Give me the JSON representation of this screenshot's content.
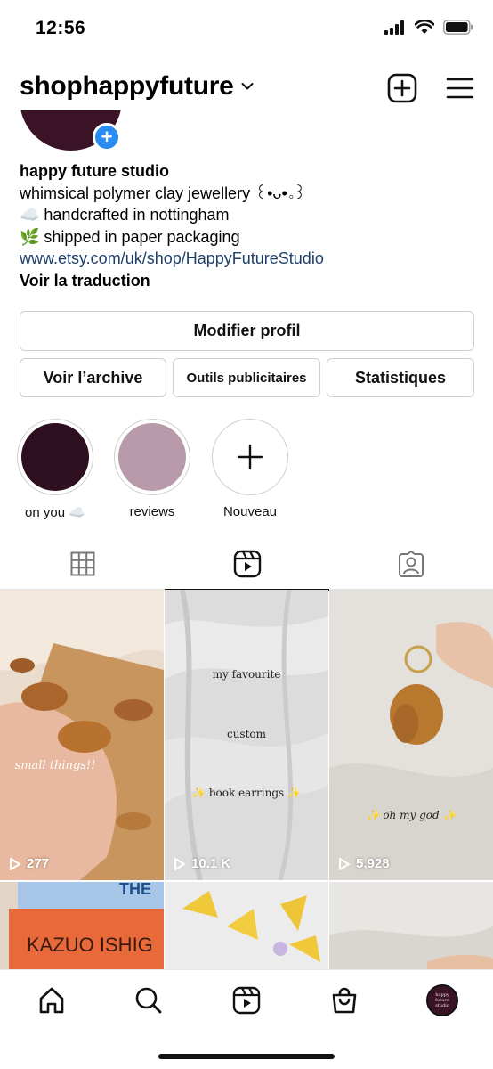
{
  "status_bar": {
    "time": "12:56"
  },
  "header": {
    "username": "shophappyfuture"
  },
  "profile": {
    "display_name": "happy future studio",
    "bio_lines": [
      "whimsical polymer clay jewellery ꒰•ᴗ•｡꒱",
      "☁️ handcrafted in nottingham",
      "🌿 shipped in paper packaging"
    ],
    "link": "www.etsy.com/uk/shop/HappyFutureStudio",
    "translate_label": "Voir la traduction"
  },
  "buttons": {
    "edit_profile": "Modifier profil",
    "archive": "Voir l’archive",
    "ad_tools": "Outils publicitaires",
    "insights": "Statistiques"
  },
  "highlights": [
    {
      "label": "on you ☁️",
      "color": "#2e0f1f"
    },
    {
      "label": "reviews",
      "color": "#b89aab"
    },
    {
      "label": "Nouveau"
    }
  ],
  "reels": [
    {
      "views": "277",
      "overlay": [
        "small things!!"
      ]
    },
    {
      "views": "10.1 K",
      "overlay": [
        "my favourite",
        "custom",
        "✨ book earrings ✨"
      ]
    },
    {
      "views": "5,928",
      "overlay": [
        "✨ oh      my      god ✨"
      ]
    }
  ],
  "partial_tiles": [
    {
      "text_lines": [
        "THE",
        "KAZUO ISHIG"
      ]
    }
  ],
  "nav": {
    "avatar_text": "happy future studio"
  },
  "colors": {
    "link": "#1f3f6b",
    "avatar": "#3a1426",
    "add_badge": "#2a8cf0"
  }
}
